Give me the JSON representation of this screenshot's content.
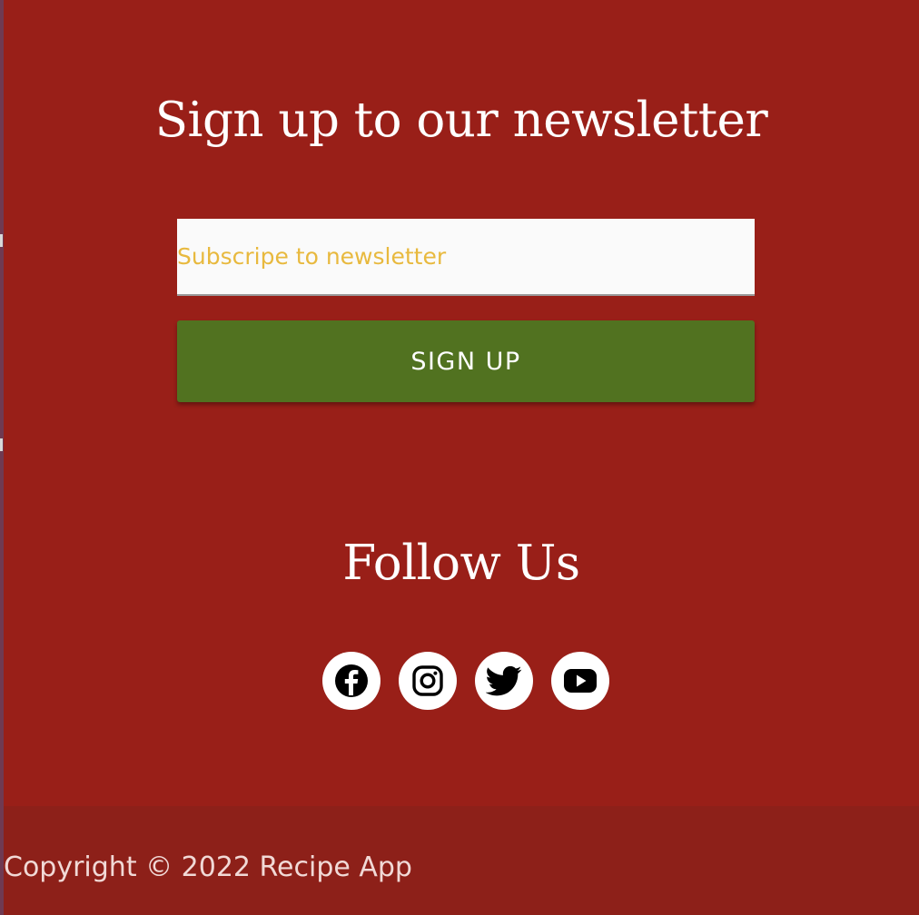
{
  "newsletter": {
    "title": "Sign up to our newsletter",
    "email_placeholder": "Subscripe to newsletter",
    "email_value": "",
    "signup_label": "SIGN UP"
  },
  "follow": {
    "title": "Follow Us",
    "social": [
      {
        "name": "facebook-icon"
      },
      {
        "name": "instagram-icon"
      },
      {
        "name": "twitter-icon"
      },
      {
        "name": "youtube-icon"
      }
    ]
  },
  "footer": {
    "copyright": "Copyright © 2022 Recipe App"
  },
  "colors": {
    "background": "#991f18",
    "footer_background": "#8d2019",
    "button": "#517220",
    "placeholder": "#e8b93e",
    "input_background": "#fafafa",
    "text": "#ffffff"
  }
}
